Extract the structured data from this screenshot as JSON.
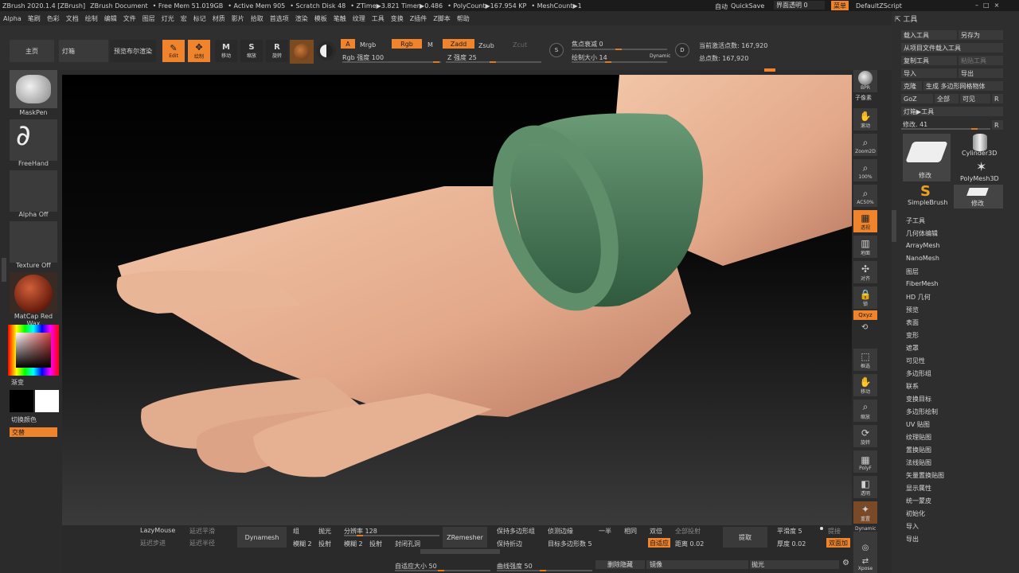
{
  "topbar": {
    "items": [
      "ZBrush 2020.1.4 [ZBrush]",
      "ZBrush Document",
      "• Free Mem 51.019GB",
      "• Active Mem 905",
      "• Scratch Disk 48",
      "• ZTime▶3.821 Timer▶0.486",
      "• PolyCount▶167.954 KP",
      "• MeshCount▶1"
    ],
    "right": {
      "auto": "自动",
      "quicksave": "QuickSave",
      "transparency": "界面透明 0",
      "menu": "菜单",
      "script": "DefaultZScript"
    }
  },
  "menubar": [
    "Alpha",
    "笔刷",
    "色彩",
    "文档",
    "绘制",
    "编辑",
    "文件",
    "图层",
    "灯光",
    "宏",
    "标记",
    "材质",
    "影片",
    "拾取",
    "首选项",
    "渲染",
    "模板",
    "笔触",
    "纹理",
    "工具",
    "变换",
    "Z插件",
    "Z脚本",
    "帮助"
  ],
  "shelf": {
    "home": "主页",
    "lightbox": "灯箱",
    "bpr": "预览布尔渲染",
    "edit": "Edit",
    "draw": "绘制",
    "move": "移动",
    "scale": "缩放",
    "rotate": "旋转",
    "a": "A",
    "mrgb": "Mrgb",
    "rgb": "Rgb",
    "m": "M",
    "rgb_intensity": "Rgb 强度 100",
    "zadd": "Zadd",
    "zsub": "Zsub",
    "zcut": "Zcut",
    "z_intensity": "Z 强度 25",
    "focal_shift": "焦点衰减 0",
    "draw_size": "绘制大小 14",
    "dynamic": "Dynamic",
    "active_points": "当前激活点数: 167,920",
    "total_points": "总点数: 167,920"
  },
  "left": {
    "maskpen": "MaskPen",
    "freehand": "FreeHand",
    "alpha_off": "Alpha Off",
    "texture_off": "Texture Off",
    "matcap": "MatCap Red Wax",
    "gradient": "渐变",
    "switch_color": "切换颜色",
    "alternate": "交替"
  },
  "rightstrip": [
    "BPR",
    "子像素",
    "滚动",
    "Zoom2D",
    "100%",
    "AC50%",
    "透视",
    "地面",
    "对齐",
    "锁",
    "Qxyz",
    "框选",
    "移动",
    "缩放",
    "旋转",
    "PolyF",
    "透明",
    "重置",
    "Dynamic",
    "Xpose"
  ],
  "rightpanel": {
    "title": "工具",
    "load_tool": "载入工具",
    "save_as": "另存为",
    "load_from_project": "从项目文件载入工具",
    "copy_tool": "复制工具",
    "paste_tool": "粘贴工具",
    "import": "导入",
    "export": "导出",
    "clone": "克隆",
    "make_polymesh": "生成 多边形网格物体",
    "goz": "GoZ",
    "all": "全部",
    "visible": "可见",
    "r": "R",
    "lightbox_tools": "灯箱▶工具",
    "edit_count": "修改. 41",
    "thumb_edit": "修改",
    "cylinder": "Cylinder3D",
    "polymesh": "PolyMesh3D",
    "simplebrush": "SimpleBrush",
    "thumb_edit2": "修改",
    "items": [
      "子工具",
      "几何体编辑",
      "ArrayMesh",
      "NanoMesh",
      "图层",
      "FiberMesh",
      "HD 几何",
      "预览",
      "表面",
      "变形",
      "遮罩",
      "可见性",
      "多边形组",
      "联系",
      "变换目标",
      "多边形绘制",
      "UV 贴图",
      "纹理贴图",
      "置换贴图",
      "法线贴图",
      "矢量置换贴图",
      "显示属性",
      "统一蒙皮",
      "初始化",
      "导入",
      "导出"
    ]
  },
  "bottom": {
    "lazymouse": "LazyMouse",
    "lazy_smooth": "延迟平滑",
    "lazy_step": "延迟步进",
    "lazy_radius": "延迟半径",
    "dynamesh": "Dynamesh",
    "group": "组",
    "polish": "抛光",
    "blur": "模糊 2",
    "project": "投射",
    "resolution": "分辨率 128",
    "blur2": "模糊 2",
    "project2": "投射",
    "close_holes": "封闭孔洞",
    "zremesher": "ZRemesher",
    "keep_groups": "保持多边形组",
    "keep_creases": "保持折边",
    "detect_edges": "侦测边缘",
    "target_poly": "目标多边形数 5",
    "half": "一半",
    "same": "相同",
    "double": "双倍",
    "all_project": "全部投射",
    "adaptive": "自适应",
    "distance": "距离 0.02",
    "extract": "提取",
    "smooth": "平滑度 5",
    "thickness": "厚度 0.02",
    "double_side": "双面加",
    "raise": "提接",
    "adaptive_size": "自适应大小 50",
    "curve_strength": "曲线强度 50",
    "delete_hidden": "删除隐藏",
    "mirror": "镜像",
    "polish2": "抛光"
  },
  "colors": {
    "accent": "#f0842c",
    "panel": "#2e2e2e",
    "button": "#3a3a3a"
  }
}
